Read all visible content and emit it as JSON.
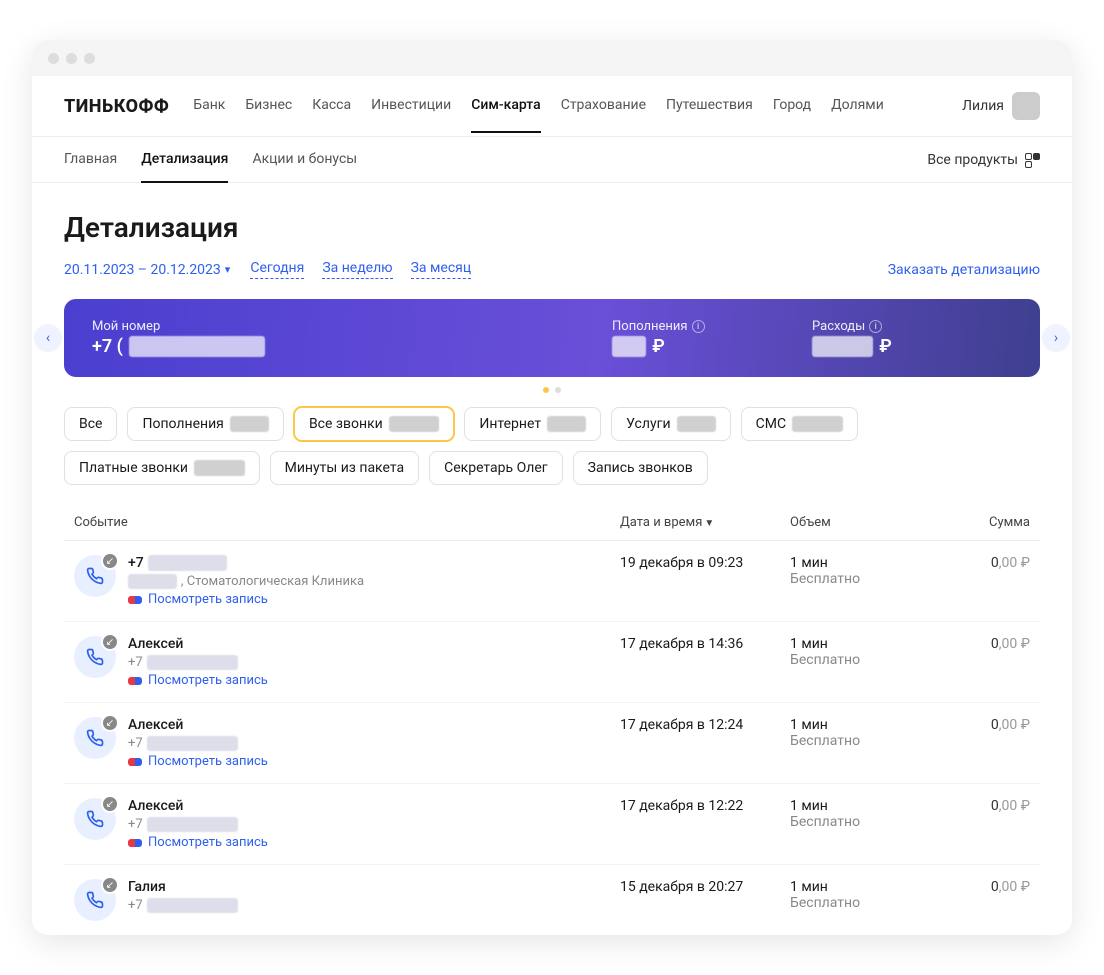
{
  "logo": "ТИНЬКОФФ",
  "mainnav": [
    "Банк",
    "Бизнес",
    "Касса",
    "Инвестиции",
    "Сим-карта",
    "Страхование",
    "Путешествия",
    "Город",
    "Долями"
  ],
  "mainnav_active": 4,
  "user_name": "Лилия",
  "subnav": [
    "Главная",
    "Детализация",
    "Акции и бонусы"
  ],
  "subnav_active": 1,
  "all_products": "Все продукты",
  "page_title": "Детализация",
  "date_range": "20.11.2023 – 20.12.2023",
  "range_links": [
    "Сегодня",
    "За неделю",
    "За месяц"
  ],
  "order_link": "Заказать детализацию",
  "card": {
    "my_number_label": "Мой номер",
    "my_number_value_prefix": "+7 (",
    "my_number_value_blur": "XXX) XXX-XX-XX",
    "top_up_label": "Пополнения",
    "top_up_blur": "XXX",
    "expenses_label": "Расходы",
    "expenses_blur": "XXX,XX"
  },
  "chips_row1": [
    {
      "label": "Все",
      "amount": null,
      "active": false
    },
    {
      "label": "Пополнения",
      "amount": "XXX ₽",
      "active": false
    },
    {
      "label": "Все звонки",
      "amount": "XX,XX ₽",
      "active": true
    },
    {
      "label": "Интернет",
      "amount": "XXX ₽",
      "active": false
    },
    {
      "label": "Услуги",
      "amount": "XXX ₽",
      "active": false
    },
    {
      "label": "СМС",
      "amount": "XX,XX ₽",
      "active": false
    },
    {
      "label": "Платные звонки",
      "amount": "XX,XX ₽",
      "active": false
    }
  ],
  "chips_row2": [
    {
      "label": "Минуты из пакета"
    },
    {
      "label": "Секретарь Олег"
    },
    {
      "label": "Запись звонков"
    }
  ],
  "table": {
    "headers": {
      "event": "Событие",
      "date": "Дата и время",
      "volume": "Объем",
      "sum": "Сумма"
    },
    "rows": [
      {
        "title": "+7",
        "title_blur": "XXXXXXXXX",
        "sub_blur": "XXXXXX",
        "sub_suffix": ", Стоматологическая Клиника",
        "record": "Посмотреть запись",
        "date": "19 декабря в 09:23",
        "vol": "1 мин",
        "volsub": "Бесплатно",
        "sum": "0,00 ₽"
      },
      {
        "title": "Алексей",
        "title_blur": null,
        "sub_prefix": "+7",
        "sub_blur": "XXX XXX XX XX",
        "record": "Посмотреть запись",
        "date": "17 декабря в 14:36",
        "vol": "1 мин",
        "volsub": "Бесплатно",
        "sum": "0,00 ₽"
      },
      {
        "title": "Алексей",
        "title_blur": null,
        "sub_prefix": "+7",
        "sub_blur": "XXX XXX XX XX",
        "record": "Посмотреть запись",
        "date": "17 декабря в 12:24",
        "vol": "1 мин",
        "volsub": "Бесплатно",
        "sum": "0,00 ₽"
      },
      {
        "title": "Алексей",
        "title_blur": null,
        "sub_prefix": "+7",
        "sub_blur": "XXX XXX XX XX",
        "record": "Посмотреть запись",
        "date": "17 декабря в 12:22",
        "vol": "1 мин",
        "volsub": "Бесплатно",
        "sum": "0,00 ₽"
      },
      {
        "title": "Галия",
        "title_blur": null,
        "sub_prefix": "+7",
        "sub_blur": "XXX XXX XX XX",
        "record": null,
        "date": "15 декабря в 20:27",
        "vol": "1 мин",
        "volsub": "Бесплатно",
        "sum": "0,00 ₽"
      }
    ]
  }
}
